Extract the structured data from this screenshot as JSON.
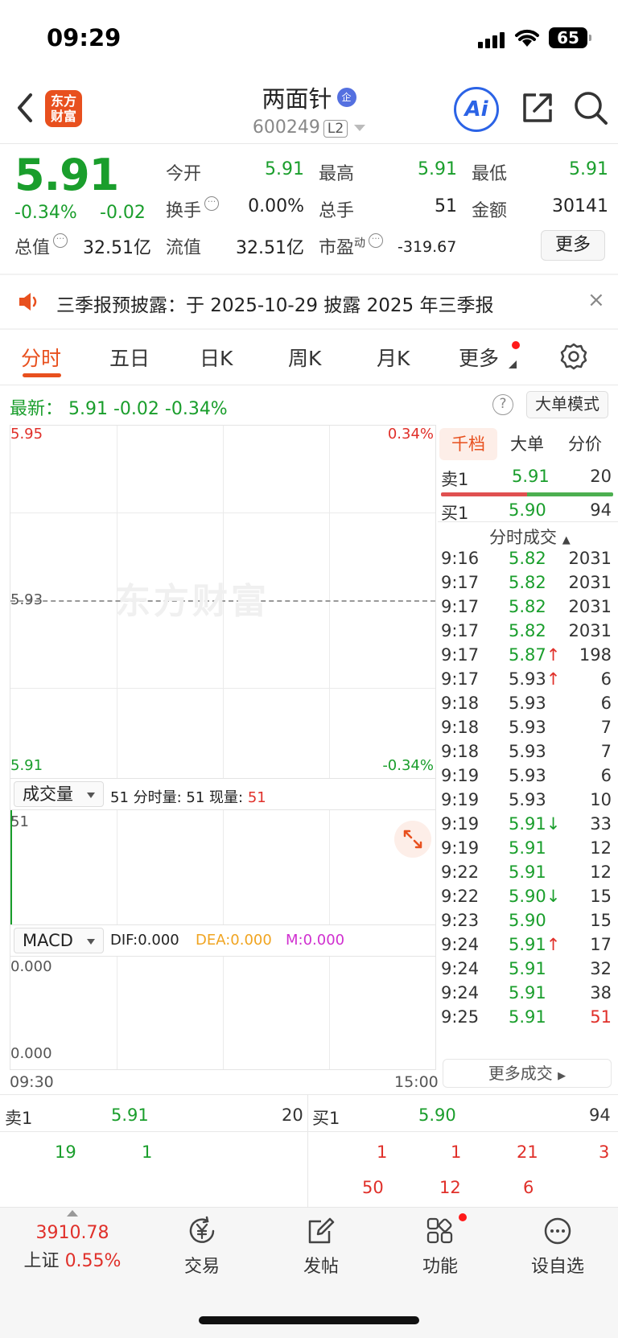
{
  "status": {
    "time": "09:29",
    "battery": "65"
  },
  "header": {
    "logo_text": "东方财富",
    "stock_name": "两面针",
    "badge": "企",
    "stock_code": "600249",
    "level": "L2",
    "ai_label": "Ai"
  },
  "quote": {
    "price": "5.91",
    "change_pct": "-0.34%",
    "change_abs": "-0.02",
    "open_label": "今开",
    "open": "5.91",
    "high_label": "最高",
    "high": "5.91",
    "low_label": "最低",
    "low": "5.91",
    "turnover_label": "换手",
    "turnover": "0.00%",
    "volume_label": "总手",
    "volume": "51",
    "amount_label": "金额",
    "amount": "30141",
    "mktcap_label": "总值",
    "mktcap": "32.51亿",
    "float_label": "流值",
    "float_cap": "32.51亿",
    "pe_label": "市盈",
    "pe_sup": "动",
    "pe": "-319.67",
    "more_label": "更多"
  },
  "notice": {
    "text": "三季报预披露：于 2025-10-29 披露 2025 年三季报",
    "close": "×"
  },
  "tabs": [
    "分时",
    "五日",
    "日K",
    "周K",
    "月K",
    "更多"
  ],
  "latest": {
    "text": "最新： 5.91  -0.02  -0.34%",
    "help": "?",
    "mode_button": "大单模式"
  },
  "chart": {
    "y_top": "5.95",
    "y_mid": "5.93",
    "y_bottom": "5.91",
    "pct_top": "0.34%",
    "pct_bottom": "-0.34%",
    "watermark": "东方财富",
    "time_start": "09:30",
    "time_end": "15:00"
  },
  "volume_panel": {
    "selector": "成交量",
    "info_prefix": "51 分时量: 51 现量: ",
    "info_now": "51",
    "axis_max": "51",
    "bar_fraction": 1.0
  },
  "macd_panel": {
    "selector": "MACD",
    "dif": "DIF:0.000",
    "dea": "DEA:0.000",
    "m": "M:0.000",
    "axis_top": "0.000",
    "axis_bottom": "0.000"
  },
  "right_panel": {
    "tabs": [
      "千档",
      "大单",
      "分价"
    ],
    "ask1": {
      "label": "卖1",
      "price": "5.91",
      "vol": "20"
    },
    "bid1": {
      "label": "买1",
      "price": "5.90",
      "vol": "94"
    },
    "trades_title": "分时成交",
    "trades": [
      {
        "time": "9:16",
        "price": "5.82",
        "arrow": "",
        "vol": "2031",
        "pc": "green",
        "vc": "gray"
      },
      {
        "time": "9:17",
        "price": "5.82",
        "arrow": "",
        "vol": "2031",
        "pc": "green",
        "vc": "gray"
      },
      {
        "time": "9:17",
        "price": "5.82",
        "arrow": "",
        "vol": "2031",
        "pc": "green",
        "vc": "gray"
      },
      {
        "time": "9:17",
        "price": "5.82",
        "arrow": "",
        "vol": "2031",
        "pc": "green",
        "vc": "gray"
      },
      {
        "time": "9:17",
        "price": "5.87",
        "arrow": "↑",
        "vol": "198",
        "pc": "green",
        "vc": "gray"
      },
      {
        "time": "9:17",
        "price": "5.93",
        "arrow": "↑",
        "vol": "6",
        "pc": "gray",
        "vc": "gray"
      },
      {
        "time": "9:18",
        "price": "5.93",
        "arrow": "",
        "vol": "6",
        "pc": "gray",
        "vc": "gray"
      },
      {
        "time": "9:18",
        "price": "5.93",
        "arrow": "",
        "vol": "7",
        "pc": "gray",
        "vc": "gray"
      },
      {
        "time": "9:18",
        "price": "5.93",
        "arrow": "",
        "vol": "7",
        "pc": "gray",
        "vc": "gray"
      },
      {
        "time": "9:19",
        "price": "5.93",
        "arrow": "",
        "vol": "6",
        "pc": "gray",
        "vc": "gray"
      },
      {
        "time": "9:19",
        "price": "5.93",
        "arrow": "",
        "vol": "10",
        "pc": "gray",
        "vc": "gray"
      },
      {
        "time": "9:19",
        "price": "5.91",
        "arrow": "↓",
        "vol": "33",
        "pc": "green",
        "vc": "gray"
      },
      {
        "time": "9:19",
        "price": "5.91",
        "arrow": "",
        "vol": "12",
        "pc": "green",
        "vc": "gray"
      },
      {
        "time": "9:22",
        "price": "5.91",
        "arrow": "",
        "vol": "12",
        "pc": "green",
        "vc": "gray"
      },
      {
        "time": "9:22",
        "price": "5.90",
        "arrow": "↓",
        "vol": "15",
        "pc": "green",
        "vc": "gray"
      },
      {
        "time": "9:23",
        "price": "5.90",
        "arrow": "",
        "vol": "15",
        "pc": "green",
        "vc": "gray"
      },
      {
        "time": "9:24",
        "price": "5.91",
        "arrow": "↑",
        "vol": "17",
        "pc": "green",
        "vc": "gray"
      },
      {
        "time": "9:24",
        "price": "5.91",
        "arrow": "",
        "vol": "32",
        "pc": "green",
        "vc": "gray"
      },
      {
        "time": "9:24",
        "price": "5.91",
        "arrow": "",
        "vol": "38",
        "pc": "green",
        "vc": "gray"
      },
      {
        "time": "9:25",
        "price": "5.91",
        "arrow": "",
        "vol": "51",
        "pc": "green",
        "vc": "red"
      }
    ],
    "more_trades": "更多成交"
  },
  "order_book": {
    "ask_label": "卖1",
    "ask_price": "5.91",
    "ask_vol": "20",
    "bid_label": "买1",
    "bid_price": "5.90",
    "bid_vol": "94",
    "ask_queue": [
      "19",
      "1"
    ],
    "bid_queue_row1": [
      "1",
      "1",
      "21",
      "3"
    ],
    "bid_queue_row2": [
      "50",
      "12",
      "6"
    ]
  },
  "tabbar": {
    "index_value": "3910.78",
    "index_name": "上证",
    "index_pct": "0.55%",
    "items": [
      "交易",
      "发帖",
      "功能",
      "设自选"
    ]
  },
  "colors": {
    "up": "#e0302a",
    "down": "#1a9e2c",
    "accent": "#e8501e",
    "ai": "#2b63e6"
  }
}
